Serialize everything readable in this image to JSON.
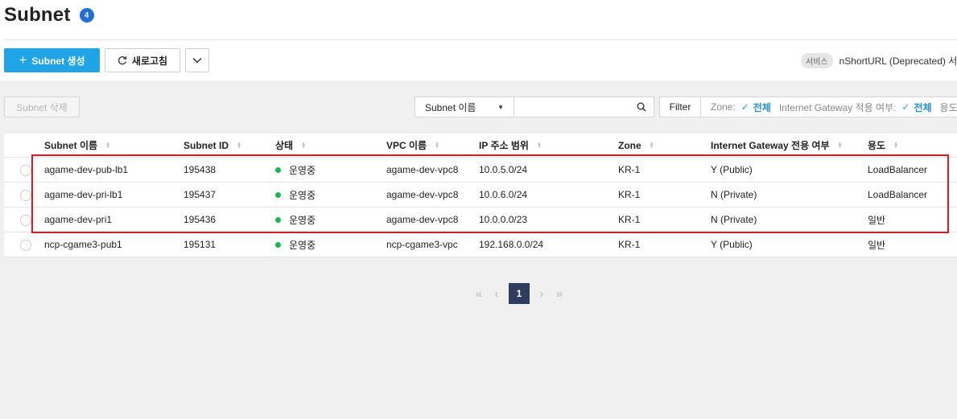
{
  "page": {
    "title": "Subnet",
    "count": "4"
  },
  "toolbar": {
    "create_label": "Subnet 생성",
    "refresh_label": "새로고침",
    "delete_label": "Subnet 삭제"
  },
  "service": {
    "tag": "서비스",
    "name": "nShortURL (Deprecated) 서비"
  },
  "search": {
    "field_selected": "Subnet 이름",
    "value": "",
    "filter_label": "Filter"
  },
  "filters": [
    {
      "key": "Zone:",
      "value": "전체"
    },
    {
      "key": "Internet Gateway 적용 여부:",
      "value": "전체"
    },
    {
      "key": "용도",
      "value": ""
    }
  ],
  "table": {
    "columns": [
      "Subnet 이름",
      "Subnet ID",
      "상태",
      "VPC 이름",
      "IP 주소 범위",
      "Zone",
      "Internet Gateway 전용 여부",
      "용도"
    ],
    "rows": [
      {
        "name": "agame-dev-pub-lb1",
        "id": "195438",
        "status": "운영중",
        "vpc": "agame-dev-vpc8",
        "ip": "10.0.5.0/24",
        "zone": "KR-1",
        "igw": "Y (Public)",
        "usage": "LoadBalancer"
      },
      {
        "name": "agame-dev-pri-lb1",
        "id": "195437",
        "status": "운영중",
        "vpc": "agame-dev-vpc8",
        "ip": "10.0.6.0/24",
        "zone": "KR-1",
        "igw": "N (Private)",
        "usage": "LoadBalancer"
      },
      {
        "name": "agame-dev-pri1",
        "id": "195436",
        "status": "운영중",
        "vpc": "agame-dev-vpc8",
        "ip": "10.0.0.0/23",
        "zone": "KR-1",
        "igw": "N (Private)",
        "usage": "일반"
      },
      {
        "name": "ncp-cgame3-pub1",
        "id": "195131",
        "status": "운영중",
        "vpc": "ncp-cgame3-vpc",
        "ip": "192.168.0.0/24",
        "zone": "KR-1",
        "igw": "Y (Public)",
        "usage": "일반"
      }
    ]
  },
  "pagination": {
    "current": "1"
  },
  "colors": {
    "primary": "#1fa4e8",
    "status_running": "#18b84e",
    "highlight": "#e8141e",
    "page_active": "#2e3d5e"
  }
}
